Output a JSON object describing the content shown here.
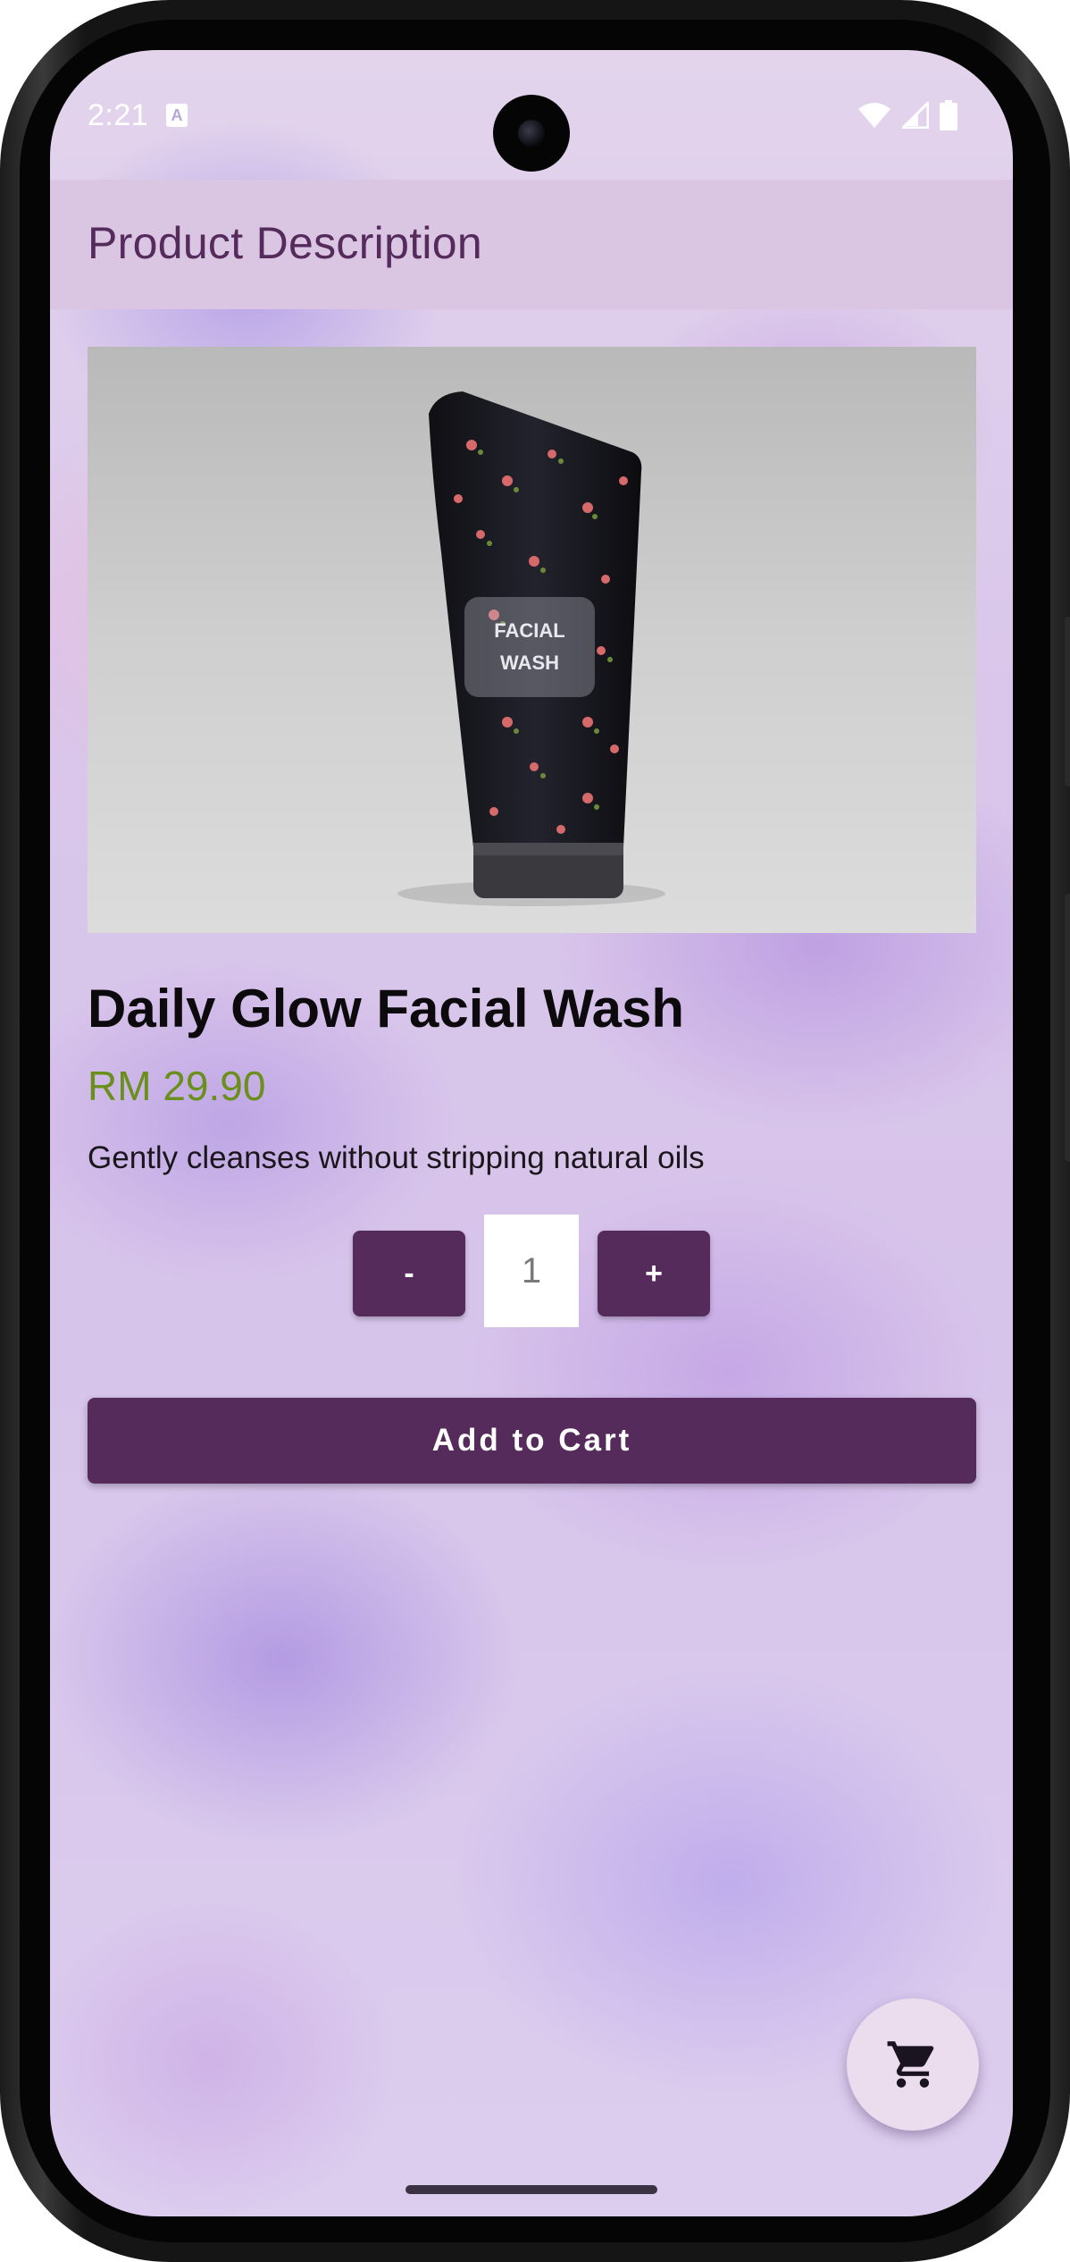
{
  "status_bar": {
    "time": "2:21",
    "notification_glyph": "A"
  },
  "app_bar": {
    "title": "Product Description"
  },
  "product": {
    "image_label_line1": "FACIAL",
    "image_label_line2": "WASH",
    "name": "Daily Glow Facial Wash",
    "price": "RM 29.90",
    "description": "Gently cleanses without stripping natural oils"
  },
  "quantity": {
    "decrement_label": "-",
    "value": "1",
    "increment_label": "+"
  },
  "actions": {
    "add_to_cart_label": "Add to Cart"
  },
  "icons": {
    "cart_fab": "cart-icon",
    "wifi": "wifi-icon",
    "signal": "signal-icon",
    "battery": "battery-icon"
  },
  "colors": {
    "primary": "#542b5b",
    "app_bar": "#dac5e3",
    "price": "#6a8f1a",
    "fab": "#ebdcee"
  }
}
